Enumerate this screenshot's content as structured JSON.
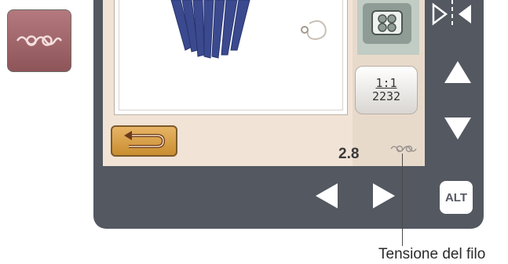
{
  "screen": {
    "tension_value": "2.8",
    "ratio_top": "1:1",
    "ratio_bottom": "2232"
  },
  "device": {
    "alt_label": "ALT"
  },
  "callout": {
    "label": "Tensione del filo"
  },
  "icons": {
    "thread_tension": "thread-tension-icon",
    "hoop": "hoop-icon",
    "undo": "undo-icon",
    "mirror": "mirror-icon",
    "up": "arrow-up-icon",
    "down": "arrow-down-icon",
    "left": "arrow-left-icon",
    "right": "arrow-right-icon"
  },
  "colors": {
    "device_body": "#535861",
    "screen_bg": "#f1e3d6",
    "tension_tile": "#a0676b",
    "undo_button": "#d9a04a",
    "embroidery_blue": "#3b4a8f"
  }
}
